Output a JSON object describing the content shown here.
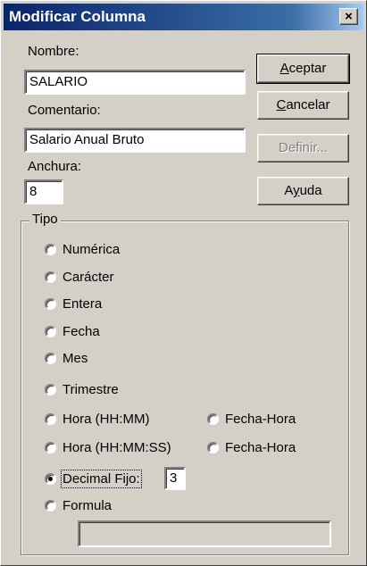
{
  "window": {
    "title": "Modificar Columna",
    "close_label": "×"
  },
  "form": {
    "nombre_label": "Nombre:",
    "nombre_value": "SALARIO",
    "comentario_label": "Comentario:",
    "comentario_value": "Salario Anual Bruto",
    "anchura_label": "Anchura:",
    "anchura_value": "8"
  },
  "buttons": {
    "aceptar": {
      "prefix": "",
      "mnemonic": "A",
      "rest": "ceptar"
    },
    "cancelar": {
      "prefix": "",
      "mnemonic": "C",
      "rest": "ancelar"
    },
    "definir": "Definir...",
    "ayuda": {
      "prefix": "A",
      "mnemonic": "y",
      "rest": "uda"
    }
  },
  "tipo": {
    "group_label": "Tipo",
    "options": [
      "Numérica",
      "Carácter",
      "Entera",
      "Fecha",
      "Mes",
      "Trimestre",
      "Hora (HH:MM)",
      "Hora (HH:MM:SS)",
      "Decimal Fijo:",
      "Formula",
      "Fecha-Hora",
      "Fecha-Hora"
    ],
    "selected": "Decimal Fijo:",
    "decimal_value": "3",
    "formula_value": ""
  }
}
